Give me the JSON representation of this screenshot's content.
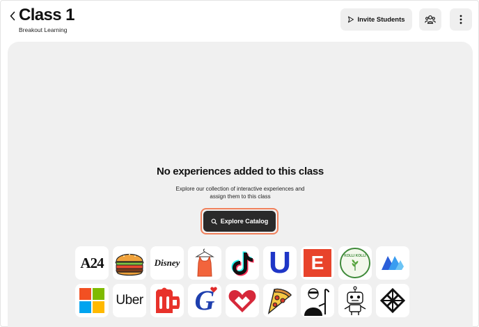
{
  "header": {
    "title": "Class 1",
    "subtitle": "Breakout Learning",
    "invite_label": "Invite Students",
    "back_icon": "chevron-left-icon",
    "people_icon": "people-icon",
    "more_icon": "more-vertical-icon"
  },
  "empty_state": {
    "title": "No experiences added to this class",
    "description": "Explore our collection of interactive experiences and assign them to this class",
    "button_label": "Explore Catalog",
    "button_icon": "search-icon",
    "highlight_color": "#f07f5a"
  },
  "logos": {
    "row1": [
      {
        "name": "a24-logo",
        "text": "A24"
      },
      {
        "name": "burger-logo"
      },
      {
        "name": "disney-logo",
        "text": "Disney"
      },
      {
        "name": "tank-top-logo"
      },
      {
        "name": "tiktok-logo"
      },
      {
        "name": "unilever-logo",
        "text": "U"
      },
      {
        "name": "e-logo",
        "text": "E"
      },
      {
        "name": "kolli-kolli-logo",
        "text": "KOLLI KOLLI"
      },
      {
        "name": "blue-w-logo"
      }
    ],
    "row2": [
      {
        "name": "microsoft-logo"
      },
      {
        "name": "uber-logo",
        "text": "Uber"
      },
      {
        "name": "mug-logo"
      },
      {
        "name": "general-mills-logo",
        "text": "G"
      },
      {
        "name": "heart-logo"
      },
      {
        "name": "pizza-logo"
      },
      {
        "name": "person-cane-logo"
      },
      {
        "name": "robot-logo"
      },
      {
        "name": "knot-logo"
      }
    ]
  }
}
